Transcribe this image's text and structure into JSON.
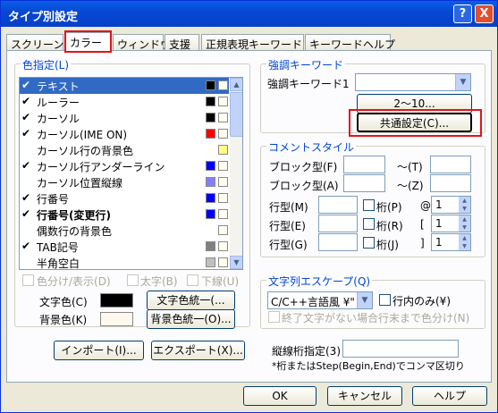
{
  "window": {
    "title": "タイプ別設定",
    "help_btn": "?",
    "close_btn": "X"
  },
  "tabs": [
    {
      "label": "スクリーン"
    },
    {
      "label": "カラー",
      "selected": true
    },
    {
      "label": "ウィンドウ"
    },
    {
      "label": "支援"
    },
    {
      "label": "正規表現キーワード"
    },
    {
      "label": "キーワードヘルプ"
    }
  ],
  "color_group": {
    "legend": "色指定(L)",
    "items": [
      {
        "label": "テキスト",
        "checked": true,
        "fg": "#000000",
        "bg": "#fffff0",
        "selected": true
      },
      {
        "label": "ルーラー",
        "checked": true,
        "fg": "#000000",
        "bg": "#fffff0"
      },
      {
        "label": "カーソル",
        "checked": true,
        "fg": "#000000",
        "bg": "#fffff0"
      },
      {
        "label": "カーソル(IME ON)",
        "checked": true,
        "fg": "#ff0000",
        "bg": "#fffff0"
      },
      {
        "label": "カーソル行の背景色",
        "checked": false,
        "fg": "",
        "bg": "#ffff80"
      },
      {
        "label": "カーソル行アンダーライン",
        "checked": true,
        "fg": "#0000ff",
        "bg": "#fffff0"
      },
      {
        "label": "カーソル位置縦線",
        "checked": false,
        "fg": "#8080ff",
        "bg": "#fffff0"
      },
      {
        "label": "行番号",
        "checked": true,
        "fg": "#0000ff",
        "bg": "#fffff0"
      },
      {
        "label": "行番号(変更行)",
        "checked": true,
        "fg": "#0000ff",
        "bg": "#fffff0",
        "bold": true
      },
      {
        "label": "偶数行の背景色",
        "checked": false,
        "fg": "",
        "bg": "#fffff0"
      },
      {
        "label": "TAB記号",
        "checked": true,
        "fg": "#808080",
        "bg": "#fffff0"
      },
      {
        "label": "半角空白",
        "checked": false,
        "fg": "#c0c0c0",
        "bg": "#fffff0"
      }
    ],
    "opt_show": "色分け/表示(D)",
    "opt_bold": "太字(B)",
    "opt_underline": "下線(U)",
    "text_color_label": "文字色(C)",
    "text_color": "#000000",
    "text_unify_btn": "文字色統一(...",
    "bg_color_label": "背景色(K)",
    "bg_color": "#fff8ee",
    "bg_unify_btn": "背景色統一(O)..."
  },
  "import_btn": "インポート(I)...",
  "export_btn": "エクスポート(X)...",
  "keyword_group": {
    "legend": "強調キーワード",
    "kw1_label": "強調キーワード1",
    "kw1_value": "",
    "btn_2to10": "2〜10...",
    "btn_common": "共通設定(C)..."
  },
  "comment_group": {
    "legend": "コメントスタイル",
    "block1_label": "ブロック型(F)",
    "block1_to": "〜(T)",
    "block2_label": "ブロック型(A)",
    "block2_to": "〜(Z)",
    "line_rows": [
      {
        "label": "行型(M)",
        "col_label": "桁(P)",
        "sym": "@",
        "value": "1"
      },
      {
        "label": "行型(E)",
        "col_label": "桁(R)",
        "sym": "[",
        "value": "1"
      },
      {
        "label": "行型(G)",
        "col_label": "桁(J)",
        "sym": "]",
        "value": "1"
      }
    ]
  },
  "escape_group": {
    "legend": "文字列エスケープ(Q)",
    "select_value": "C/C++言語風 ¥\"",
    "inline_only": "行内のみ(¥)",
    "no_end_label": "終了文字がない場合行末まで色分け(N)"
  },
  "vline": {
    "label": "縦線桁指定(3)",
    "value": "",
    "hint": "*桁またはStep(Begin,End)でコンマ区切り"
  },
  "footer": {
    "ok": "OK",
    "cancel": "キャンセル",
    "help": "ヘルプ"
  },
  "colors": {
    "accent": "#0046d5",
    "highlight": "#e4121b",
    "selection": "#316ac5"
  }
}
